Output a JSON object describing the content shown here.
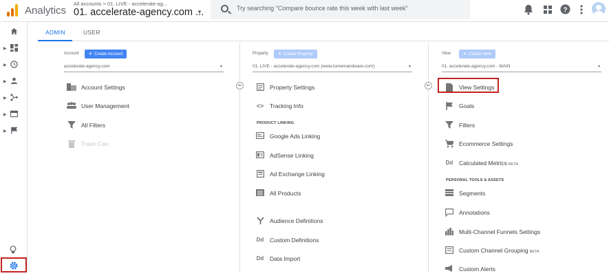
{
  "app": {
    "title": "Analytics",
    "breadcrumb": "All accounts > 01. LIVE - accelerate-ag...",
    "property_title": "01. accelerate-agency.com ...",
    "logo_colors": [
      "#f9ab00",
      "#e37400",
      "#e37400"
    ]
  },
  "search": {
    "placeholder": "Try searching \"Compare bounce rate this week with last week\""
  },
  "tabs": [
    {
      "label": "ADMIN",
      "active": true
    },
    {
      "label": "USER",
      "active": false
    }
  ],
  "account": {
    "header": "Account",
    "create_label": "Create Account",
    "selected": "accelerate-agency.com",
    "items": [
      {
        "label": "Account Settings",
        "icon": "building-icon",
        "enabled": true
      },
      {
        "label": "User Management",
        "icon": "people-icon",
        "enabled": true
      },
      {
        "label": "All Filters",
        "icon": "filter-icon",
        "enabled": true
      },
      {
        "label": "Trash Can",
        "icon": "trash-icon",
        "enabled": false
      }
    ]
  },
  "property": {
    "header": "Property",
    "create_label": "Create Property",
    "selected": "01. LIVE - accelerate-agency.com (www.lomemandware.com)",
    "items": [
      {
        "label": "Property Settings",
        "icon": "settings-doc-icon"
      },
      {
        "label": "Tracking Info",
        "icon": "code-icon"
      }
    ],
    "section_label": "PRODUCT LINKING",
    "linking": [
      {
        "label": "Google Ads Linking",
        "icon": "ads-icon"
      },
      {
        "label": "AdSense Linking",
        "icon": "adsense-icon"
      },
      {
        "label": "Ad Exchange Linking",
        "icon": "adx-icon"
      },
      {
        "label": "All Products",
        "icon": "products-icon"
      }
    ],
    "more": [
      {
        "label": "Audience Definitions",
        "icon": "fork-icon"
      },
      {
        "label": "Custom Definitions",
        "icon": "dd-icon"
      },
      {
        "label": "Data Import",
        "icon": "dd-icon"
      }
    ]
  },
  "view": {
    "header": "View",
    "create_label": "Create View",
    "selected": "01. accelerate-agency.com - MAIN",
    "items": [
      {
        "label": "View Settings",
        "icon": "document-icon"
      },
      {
        "label": "Goals",
        "icon": "flag-icon"
      },
      {
        "label": "Filters",
        "icon": "filter-icon"
      },
      {
        "label": "Ecommerce Settings",
        "icon": "cart-icon"
      },
      {
        "label": "Calculated Metrics",
        "icon": "dd-icon",
        "badge": "BETA"
      }
    ],
    "section_label": "PERSONAL TOOLS & ASSETS",
    "tools": [
      {
        "label": "Segments",
        "icon": "segments-icon"
      },
      {
        "label": "Annotations",
        "icon": "comment-icon"
      },
      {
        "label": "Multi-Channel Funnels Settings",
        "icon": "bars-icon"
      },
      {
        "label": "Custom Channel Grouping",
        "icon": "grouping-icon",
        "badge": "BETA"
      },
      {
        "label": "Custom Alerts",
        "icon": "megaphone-icon"
      }
    ]
  },
  "colors": {
    "accent": "#1a73e8",
    "highlight": "#c5221f"
  }
}
